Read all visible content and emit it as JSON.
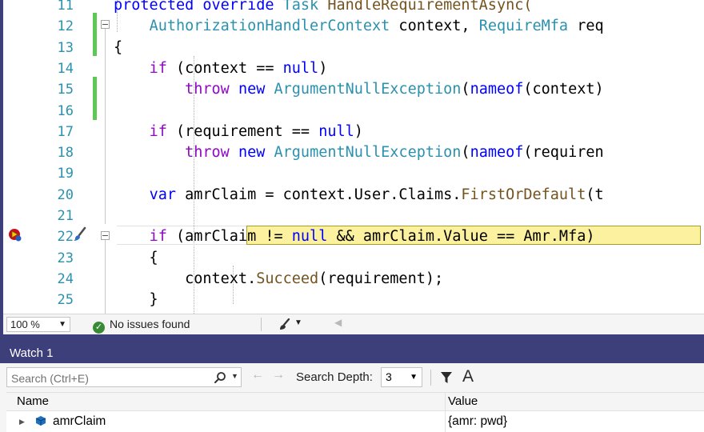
{
  "editor": {
    "lines": [
      {
        "num": "11",
        "tokens": [
          {
            "t": "protected override ",
            "c": "kw"
          },
          {
            "t": "Task ",
            "c": "ty"
          },
          {
            "t": "HandleRequirementAsync(",
            "c": "mt"
          }
        ]
      },
      {
        "num": "12",
        "tokens": [
          {
            "t": "    "
          },
          {
            "t": "AuthorizationHandlerContext",
            "c": "ty"
          },
          {
            "t": " context, "
          },
          {
            "t": "RequireMfa",
            "c": "ty"
          },
          {
            "t": " req"
          }
        ]
      },
      {
        "num": "13",
        "tokens": [
          {
            "t": "{"
          }
        ]
      },
      {
        "num": "14",
        "tokens": [
          {
            "t": "    "
          },
          {
            "t": "if",
            "c": "ctl"
          },
          {
            "t": " (context == "
          },
          {
            "t": "null",
            "c": "kw"
          },
          {
            "t": ")"
          }
        ]
      },
      {
        "num": "15",
        "tokens": [
          {
            "t": "        "
          },
          {
            "t": "throw",
            "c": "ctl"
          },
          {
            "t": " "
          },
          {
            "t": "new",
            "c": "kw"
          },
          {
            "t": " "
          },
          {
            "t": "ArgumentNullException",
            "c": "ty"
          },
          {
            "t": "("
          },
          {
            "t": "nameof",
            "c": "kw"
          },
          {
            "t": "(context)"
          }
        ]
      },
      {
        "num": "16",
        "tokens": []
      },
      {
        "num": "17",
        "tokens": [
          {
            "t": "    "
          },
          {
            "t": "if",
            "c": "ctl"
          },
          {
            "t": " (requirement == "
          },
          {
            "t": "null",
            "c": "kw"
          },
          {
            "t": ")"
          }
        ]
      },
      {
        "num": "18",
        "tokens": [
          {
            "t": "        "
          },
          {
            "t": "throw",
            "c": "ctl"
          },
          {
            "t": " "
          },
          {
            "t": "new",
            "c": "kw"
          },
          {
            "t": " "
          },
          {
            "t": "ArgumentNullException",
            "c": "ty"
          },
          {
            "t": "("
          },
          {
            "t": "nameof",
            "c": "kw"
          },
          {
            "t": "(requiren"
          }
        ]
      },
      {
        "num": "19",
        "tokens": []
      },
      {
        "num": "20",
        "tokens": [
          {
            "t": "    "
          },
          {
            "t": "var",
            "c": "kw"
          },
          {
            "t": " amrClaim = context.User.Claims."
          },
          {
            "t": "FirstOrDefault",
            "c": "mt"
          },
          {
            "t": "(t"
          }
        ]
      },
      {
        "num": "21",
        "tokens": []
      },
      {
        "num": "22",
        "tokens": [
          {
            "t": "    "
          },
          {
            "t": "if",
            "c": "ctl"
          },
          {
            "t": " (amrClaim != "
          },
          {
            "t": "null",
            "c": "kw"
          },
          {
            "t": " && amrClaim.Value == Amr.Mfa)"
          }
        ]
      },
      {
        "num": "23",
        "tokens": [
          {
            "t": "    {"
          }
        ]
      },
      {
        "num": "24",
        "tokens": [
          {
            "t": "        context."
          },
          {
            "t": "Succeed",
            "c": "mt"
          },
          {
            "t": "(requirement);"
          }
        ]
      },
      {
        "num": "25",
        "tokens": [
          {
            "t": "    }"
          }
        ]
      }
    ]
  },
  "statusbar": {
    "zoom": "100 %",
    "issues": "No issues found"
  },
  "watch": {
    "title": "Watch 1",
    "search_placeholder": "Search (Ctrl+E)",
    "depth_label": "Search Depth:",
    "depth_value": "3",
    "col_name": "Name",
    "col_value": "Value",
    "rows": [
      {
        "name": "amrClaim",
        "value": "{amr: pwd}"
      }
    ]
  },
  "colors": {
    "keyword": "#0000ff",
    "control": "#8f08c4",
    "type": "#2b91af",
    "method": "#74531f",
    "highlight": "#fcf19e",
    "change_bar": "#5ec857",
    "window_frame": "#3c3f7a"
  },
  "icons": {
    "breakpoint": "breakpoint-current-icon",
    "quick_action": "paintbrush-icon",
    "ok": "check-circle-icon",
    "search": "search-icon",
    "back": "arrow-left-icon",
    "forward": "arrow-right-icon",
    "filter": "filter-icon",
    "font": "font-icon",
    "expand": "triangle-right-icon",
    "field": "field-cube-icon"
  }
}
